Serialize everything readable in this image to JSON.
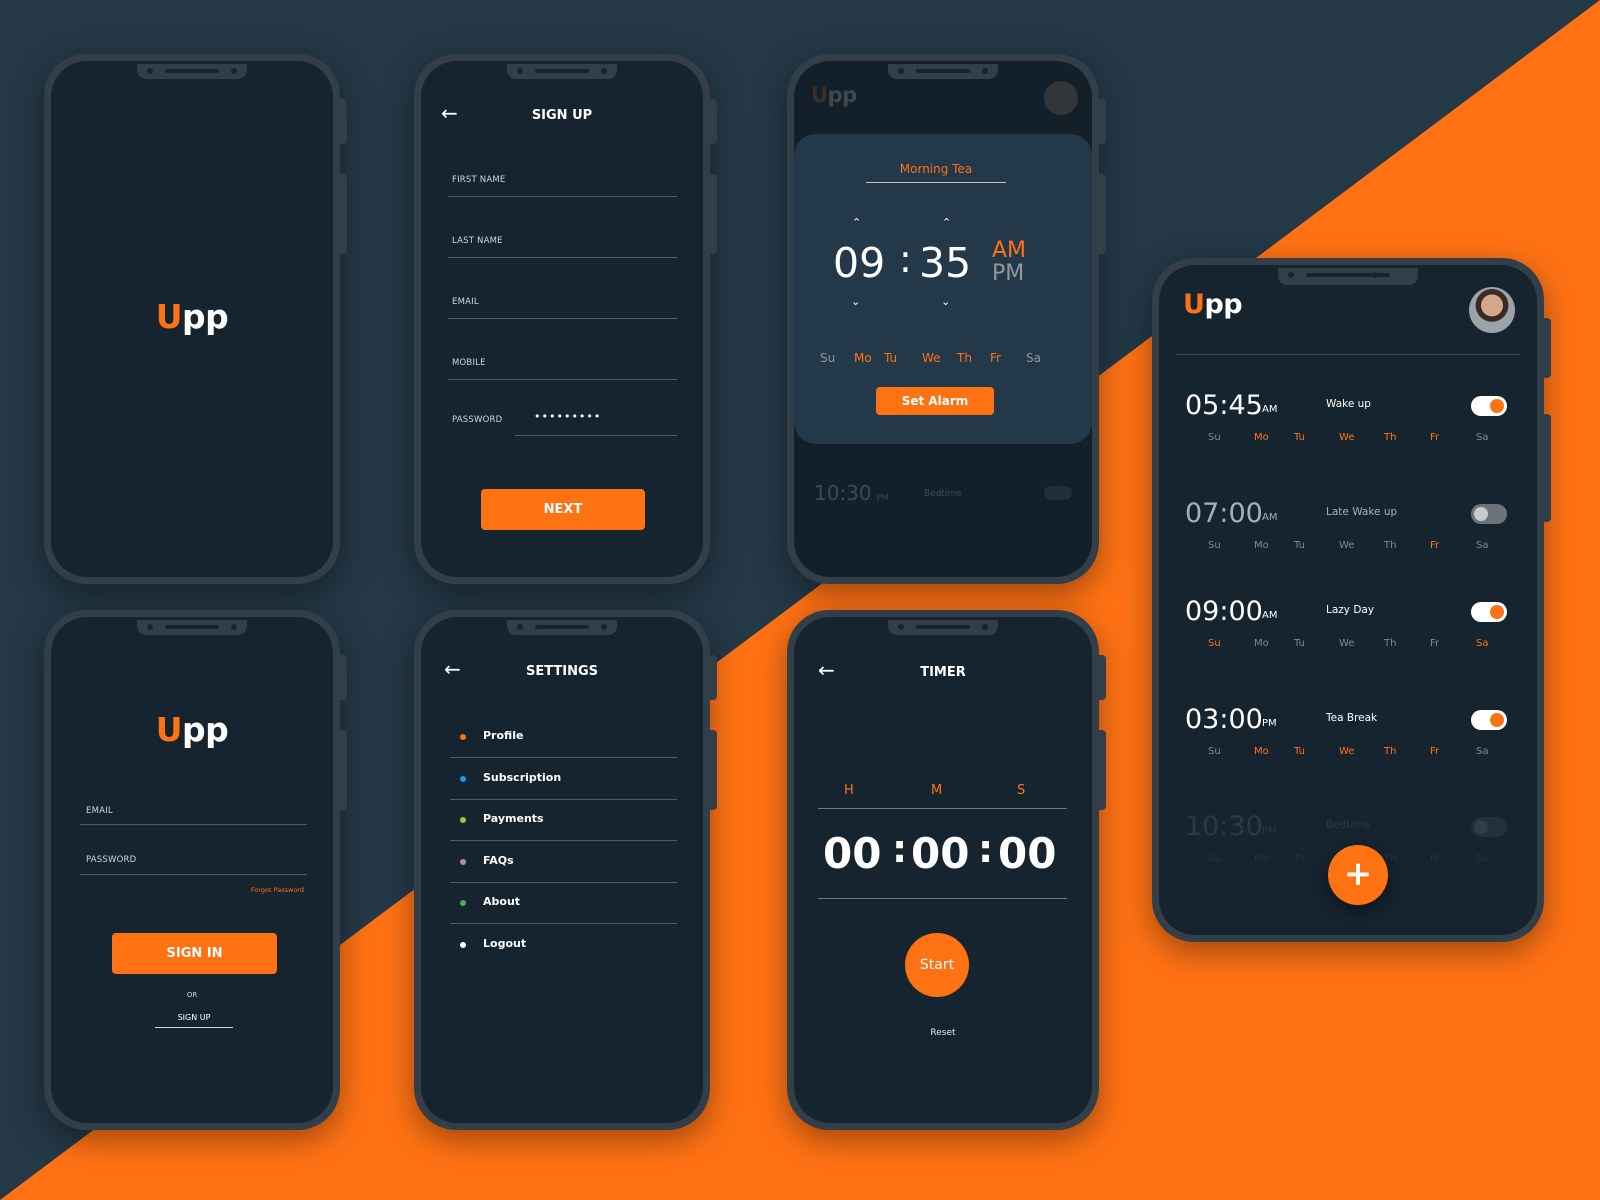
{
  "brand": {
    "logo_u": "U",
    "logo_pp": "pp"
  },
  "colors": {
    "accent": "#ff7214",
    "bg_dark": "#243846",
    "screen": "#16242f",
    "frame": "#323f49"
  },
  "signup": {
    "title": "SIGN UP",
    "fields": {
      "first_name": "FIRST NAME",
      "last_name": "LAST NAME",
      "email": "EMAIL",
      "mobile": "MOBILE",
      "password": "PASSWORD"
    },
    "password_value": "•••••••••",
    "next": "NEXT"
  },
  "signin": {
    "email": "EMAIL",
    "password": "PASSWORD",
    "forgot": "Forgot Password",
    "sign_in": "SIGN IN",
    "or": "OR",
    "sign_up": "SIGN UP"
  },
  "alarm_editor": {
    "name": "Morning Tea",
    "hour": "09",
    "colon": ":",
    "minute": "35",
    "am": "AM",
    "pm": "PM",
    "days": [
      "Su",
      "Mo",
      "Tu",
      "We",
      "Th",
      "Fr",
      "Sa"
    ],
    "active_days": [
      false,
      true,
      true,
      true,
      true,
      true,
      false
    ],
    "set_alarm": "Set Alarm",
    "bg_time": "10:30",
    "bg_ampm": "PM",
    "bg_label": "Bedtime"
  },
  "settings": {
    "title": "SETTINGS",
    "items": [
      {
        "label": "Profile",
        "dot": "#ff7214"
      },
      {
        "label": "Subscription",
        "dot": "#2196f3"
      },
      {
        "label": "Payments",
        "dot": "#9bc53d"
      },
      {
        "label": "FAQs",
        "dot": "#b08bb0"
      },
      {
        "label": "About",
        "dot": "#4caf50"
      },
      {
        "label": "Logout",
        "dot": "#ffffff"
      }
    ]
  },
  "timer": {
    "title": "TIMER",
    "h": "H",
    "m": "M",
    "s": "S",
    "hh": "00",
    "mm": "00",
    "ss": "00",
    "colon": ":",
    "start": "Start",
    "reset": "Reset"
  },
  "alarm_list": {
    "days": [
      "Su",
      "Mo",
      "Tu",
      "We",
      "Th",
      "Fr",
      "Sa"
    ],
    "alarms": [
      {
        "time": "05:45",
        "ampm": "AM",
        "label": "Wake up",
        "on": true,
        "active": [
          false,
          true,
          true,
          true,
          true,
          true,
          false
        ]
      },
      {
        "time": "07:00",
        "ampm": "AM",
        "label": "Late Wake up",
        "on": false,
        "active": [
          false,
          false,
          false,
          false,
          false,
          true,
          false
        ]
      },
      {
        "time": "09:00",
        "ampm": "AM",
        "label": "Lazy Day",
        "on": true,
        "active": [
          true,
          false,
          false,
          false,
          false,
          false,
          true
        ]
      },
      {
        "time": "03:00",
        "ampm": "PM",
        "label": "Tea Break",
        "on": true,
        "active": [
          false,
          true,
          true,
          true,
          true,
          true,
          false
        ]
      },
      {
        "time": "10:30",
        "ampm": "PM",
        "label": "Bedtime",
        "on": false,
        "active": [
          false,
          false,
          false,
          false,
          false,
          false,
          false
        ]
      }
    ],
    "fab": "+"
  }
}
